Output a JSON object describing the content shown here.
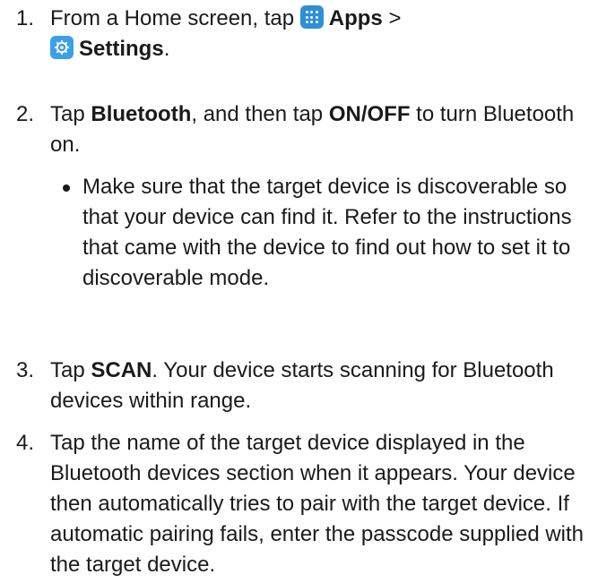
{
  "steps": [
    {
      "number": "1.",
      "text_before": "From a Home screen, tap",
      "apps_label": "Apps",
      "separator": " >",
      "settings_label": "Settings",
      "text_after": "."
    },
    {
      "number": "2.",
      "text_a": "Tap ",
      "bold_a": "Bluetooth",
      "text_b": ", and then tap ",
      "bold_b": "ON/OFF",
      "text_c": " to turn Bluetooth on."
    },
    {
      "number": "3.",
      "text_a": "Tap ",
      "bold_a": "SCAN",
      "text_b": ". Your device starts scanning for Bluetooth devices within range."
    },
    {
      "number": "4.",
      "text": "Tap the name of the target device displayed in the Bluetooth devices section when it appears. Your device then automatically tries to pair with the target device. If automatic pairing fails, enter the passcode supplied with the target device."
    }
  ],
  "bullet": {
    "text": "Make sure that the target device is discoverable so that your device can find it. Refer to the instructions that came with the device to find out how to set it to discoverable mode."
  },
  "icons": {
    "apps": "apps-grid-icon",
    "settings": "settings-gear-icon"
  },
  "colors": {
    "apps_icon": "#2e8fd6",
    "settings_icon": "#3aa0e8",
    "text": "#1a1a1a"
  }
}
